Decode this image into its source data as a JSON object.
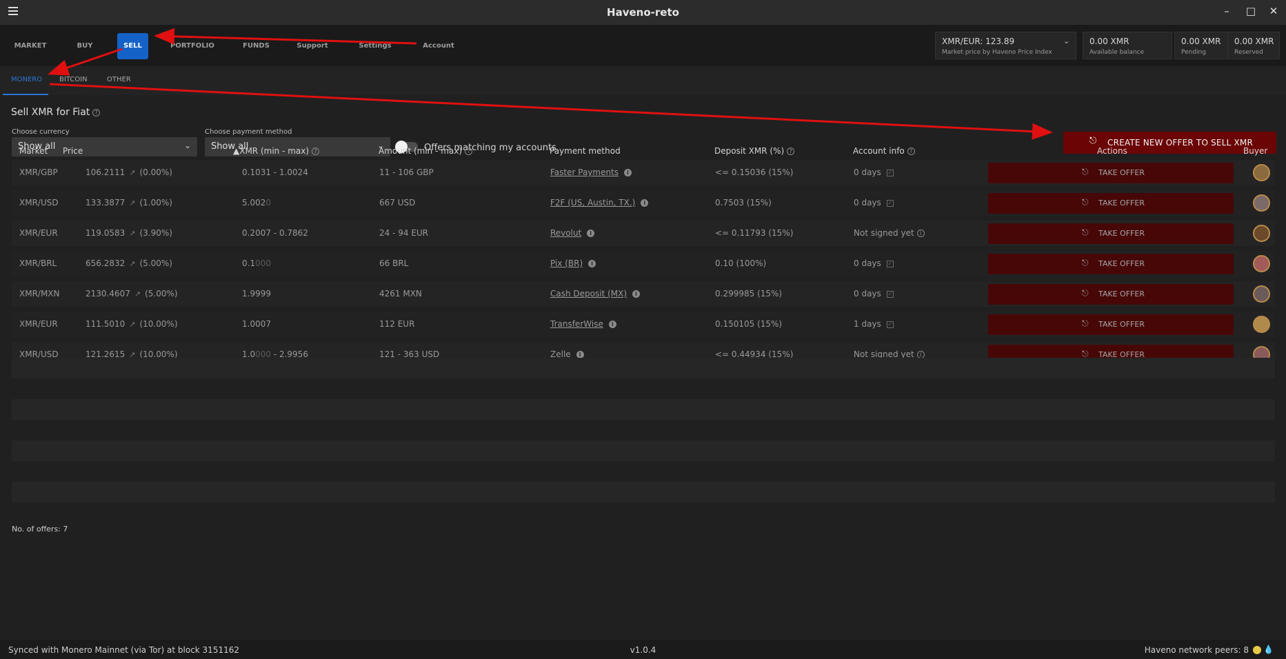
{
  "window": {
    "title": "Haveno-reto"
  },
  "nav": {
    "tabs": [
      {
        "label": "MARKET"
      },
      {
        "label": "BUY"
      },
      {
        "label": "SELL"
      },
      {
        "label": "PORTFOLIO"
      },
      {
        "label": "FUNDS"
      },
      {
        "label": "Support"
      },
      {
        "label": "Settings"
      },
      {
        "label": "Account"
      }
    ],
    "active": "SELL"
  },
  "market_price": {
    "value": "XMR/EUR: 123.89",
    "caption": "Market price by Haveno Price Index"
  },
  "balances": [
    {
      "value": "0.00 XMR",
      "caption": "Available balance"
    },
    {
      "value": "0.00 XMR",
      "caption": "Pending"
    },
    {
      "value": "0.00 XMR",
      "caption": "Reserved"
    }
  ],
  "subtabs": [
    {
      "label": "MONERO"
    },
    {
      "label": "BITCOIN"
    },
    {
      "label": "OTHER"
    }
  ],
  "page": {
    "heading": "Sell XMR for Fiat",
    "currency_label": "Choose currency",
    "currency_value": "Show all",
    "payment_label": "Choose payment method",
    "payment_value": "Show all",
    "toggle_label": "Offers matching my accounts",
    "create_button": "CREATE NEW OFFER TO SELL XMR"
  },
  "table": {
    "headers": {
      "market": "Market",
      "price": "Price",
      "xmr": "XMR (min - max)",
      "amount": "Amount (min - max)",
      "payment": "Payment method",
      "deposit": "Deposit XMR (%)",
      "account": "Account info",
      "actions": "Actions",
      "buyer": "Buyer"
    },
    "take_label": "TAKE OFFER",
    "rows": [
      {
        "market": "XMR/GBP",
        "price": "106.2111",
        "pct": "(0.00%)",
        "xmr": "0.1031 - 1.0024",
        "xmr_dim": "",
        "xmr_tail": "",
        "amount": "11 - 106 GBP",
        "payment": "Faster Payments",
        "deposit": "<= 0.15036 (15%)",
        "account": "0 days",
        "account_icon": "check"
      },
      {
        "market": "XMR/USD",
        "price": "133.3877",
        "pct": "(1.00%)",
        "xmr": "5.002",
        "xmr_dim": "0",
        "xmr_tail": "",
        "amount": "667 USD",
        "payment": "F2F (US, Austin, TX.)",
        "deposit": "0.7503 (15%)",
        "account": "0 days",
        "account_icon": "check"
      },
      {
        "market": "XMR/EUR",
        "price": "119.0583",
        "pct": "(3.90%)",
        "xmr": "0.2007 - 0.7862",
        "xmr_dim": "",
        "xmr_tail": "",
        "amount": "24 - 94 EUR",
        "payment": "Revolut",
        "deposit": "<= 0.11793 (15%)",
        "account": "Not signed yet",
        "account_icon": "info"
      },
      {
        "market": "XMR/BRL",
        "price": "656.2832",
        "pct": "(5.00%)",
        "xmr": "0.1",
        "xmr_dim": "000",
        "xmr_tail": "",
        "amount": "66 BRL",
        "payment": "Pix (BR)",
        "deposit": "0.10 (100%)",
        "account": "0 days",
        "account_icon": "check"
      },
      {
        "market": "XMR/MXN",
        "price": "2130.4607",
        "pct": "(5.00%)",
        "xmr": "1.9999",
        "xmr_dim": "",
        "xmr_tail": "",
        "amount": "4261 MXN",
        "payment": "Cash Deposit (MX)",
        "deposit": "0.299985 (15%)",
        "account": "0 days",
        "account_icon": "check"
      },
      {
        "market": "XMR/EUR",
        "price": "111.5010",
        "pct": "(10.00%)",
        "xmr": "1.0007",
        "xmr_dim": "",
        "xmr_tail": "",
        "amount": "112 EUR",
        "payment": "TransferWise",
        "deposit": "0.150105 (15%)",
        "account": "1 days",
        "account_icon": "check"
      },
      {
        "market": "XMR/USD",
        "price": "121.2615",
        "pct": "(10.00%)",
        "xmr": "1.0",
        "xmr_dim": "000",
        "xmr_tail": " - 2.9956",
        "amount": "121 - 363 USD",
        "payment": "Zelle",
        "deposit": "<= 0.44934 (15%)",
        "account": "Not signed yet",
        "account_icon": "info"
      }
    ]
  },
  "footer": {
    "offer_count": "No. of offers: 7"
  },
  "status": {
    "sync": "Synced with Monero Mainnet (via Tor) at block 3151162",
    "version": "v1.0.4",
    "peers": "Haveno network peers: 8"
  },
  "colors": {
    "accent": "#1462c7",
    "create_button": "#6b0505",
    "take_button": "#470707",
    "annotation_arrow": "#e01010"
  }
}
